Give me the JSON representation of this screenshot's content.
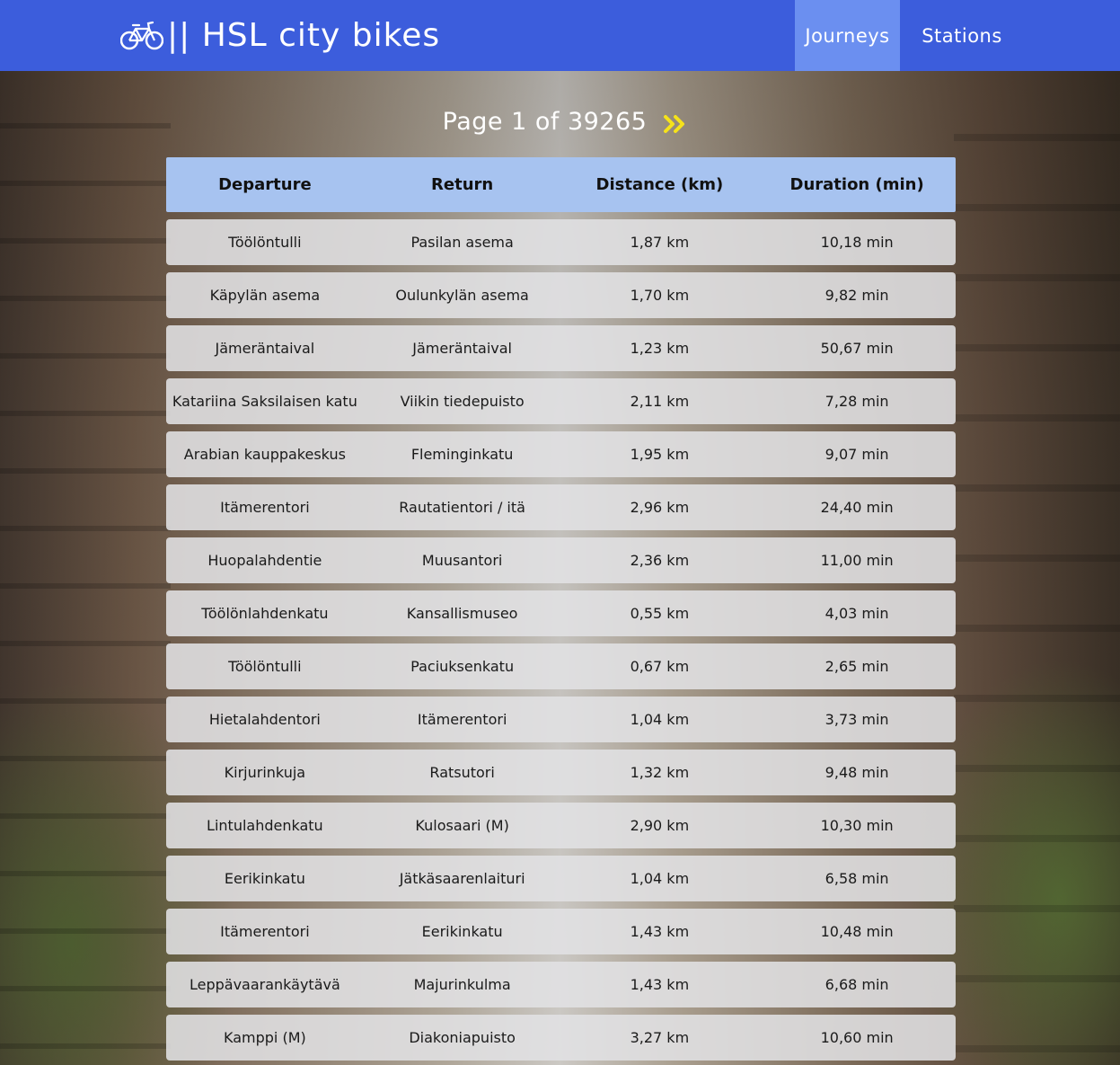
{
  "brand": {
    "title": "|| HSL city bikes",
    "icon": "bicycle-icon"
  },
  "nav": {
    "journeys_label": "Journeys",
    "stations_label": "Stations",
    "active": "Journeys"
  },
  "pager": {
    "text": "Page 1 of 39265",
    "next_icon": "double-chevron-right-icon",
    "current_page": 1,
    "total_pages": 39265
  },
  "table": {
    "headers": [
      "Departure",
      "Return",
      "Distance (km)",
      "Duration (min)"
    ],
    "rows": [
      [
        "Töölöntulli",
        "Pasilan asema",
        "1,87 km",
        "10,18 min"
      ],
      [
        "Käpylän asema",
        "Oulunkylän asema",
        "1,70 km",
        "9,82 min"
      ],
      [
        "Jämeräntaival",
        "Jämeräntaival",
        "1,23 km",
        "50,67 min"
      ],
      [
        "Katariina Saksilaisen katu",
        "Viikin tiedepuisto",
        "2,11 km",
        "7,28 min"
      ],
      [
        "Arabian kauppakeskus",
        "Fleminginkatu",
        "1,95 km",
        "9,07 min"
      ],
      [
        "Itämerentori",
        "Rautatientori / itä",
        "2,96 km",
        "24,40 min"
      ],
      [
        "Huopalahdentie",
        "Muusantori",
        "2,36 km",
        "11,00 min"
      ],
      [
        "Töölönlahdenkatu",
        "Kansallismuseo",
        "0,55 km",
        "4,03 min"
      ],
      [
        "Töölöntulli",
        "Paciuksenkatu",
        "0,67 km",
        "2,65 min"
      ],
      [
        "Hietalahdentori",
        "Itämerentori",
        "1,04 km",
        "3,73 min"
      ],
      [
        "Kirjurinkuja",
        "Ratsutori",
        "1,32 km",
        "9,48 min"
      ],
      [
        "Lintulahdenkatu",
        "Kulosaari (M)",
        "2,90 km",
        "10,30 min"
      ],
      [
        "Eerikinkatu",
        "Jätkäsaarenlaituri",
        "1,04 km",
        "6,58 min"
      ],
      [
        "Itämerentori",
        "Eerikinkatu",
        "1,43 km",
        "10,48 min"
      ],
      [
        "Leppävaarankäytävä",
        "Majurinkulma",
        "1,43 km",
        "6,68 min"
      ],
      [
        "Kamppi (M)",
        "Diakoniapuisto",
        "3,27 km",
        "10,60 min"
      ]
    ]
  },
  "colors": {
    "navbar": "#3c5ddc",
    "nav_active": "#6b8ff0",
    "table_header": "#a7c3f0",
    "pager_arrow": "#f5e21b"
  }
}
